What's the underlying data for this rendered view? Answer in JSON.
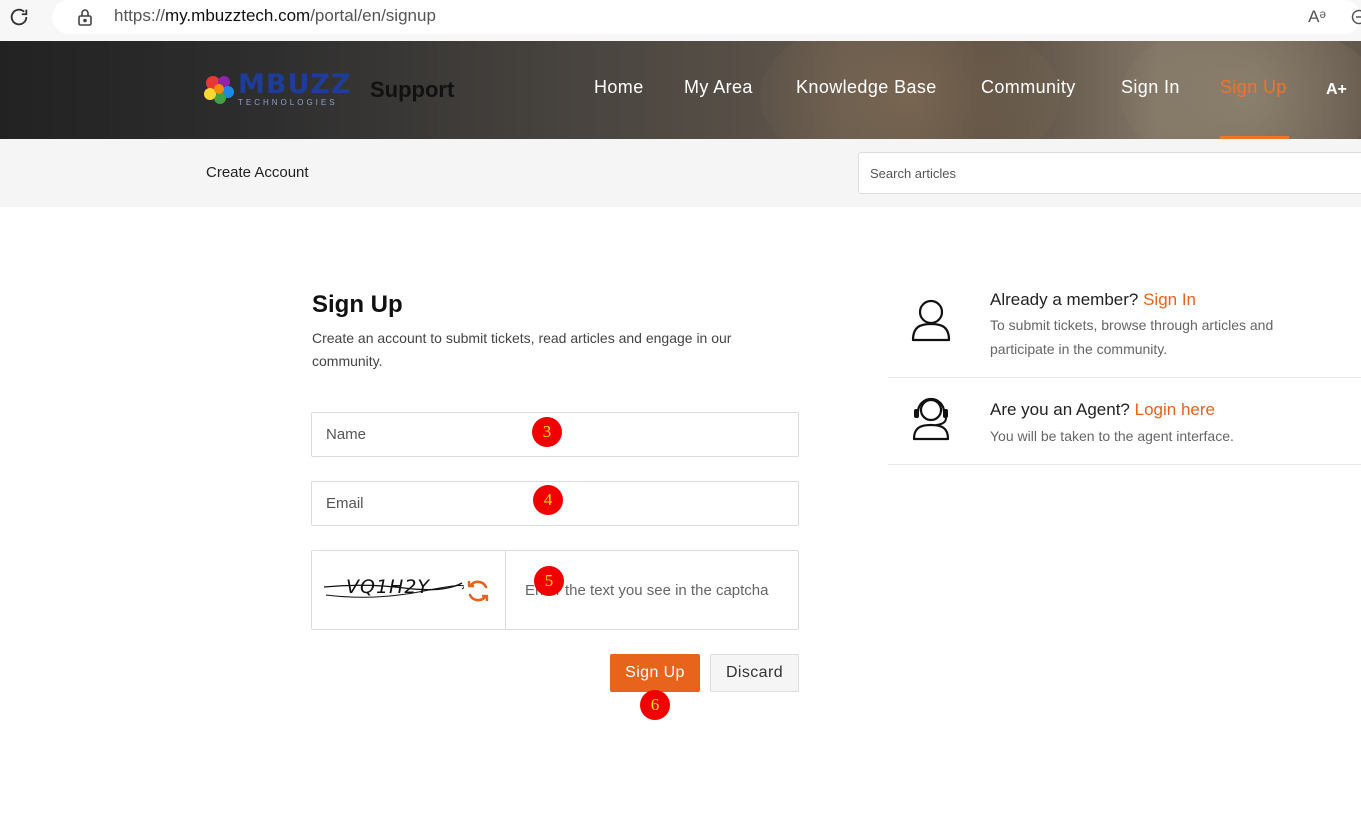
{
  "browser": {
    "url_prefix": "https://",
    "url_host": "my.mbuzztech.com",
    "url_path": "/portal/en/signup",
    "read_aloud_icon": "Aᵊ"
  },
  "header": {
    "logo_main": "MBUZZ",
    "logo_sub": "TECHNOLOGIES",
    "portal_name": "Support",
    "nav": [
      {
        "label": "Home"
      },
      {
        "label": "My Area"
      },
      {
        "label": "Knowledge Base"
      },
      {
        "label": "Community"
      },
      {
        "label": "Sign In"
      },
      {
        "label": "Sign Up"
      }
    ],
    "a11y_label": "A+",
    "accent_color": "#f0742a"
  },
  "subbar": {
    "breadcrumb": "Create Account",
    "search_placeholder": "Search articles"
  },
  "form": {
    "title": "Sign Up",
    "description": "Create an account to submit tickets, read articles and engage in our community.",
    "name_placeholder": "Name",
    "email_placeholder": "Email",
    "captcha_text": "VQ1H2Y",
    "captcha_placeholder": "Enter the text you see in the captcha",
    "submit_label": "Sign Up",
    "discard_label": "Discard"
  },
  "markers": [
    "3",
    "4",
    "5",
    "6"
  ],
  "sidebar": {
    "member": {
      "question": "Already a member?",
      "link": "Sign In",
      "text": "To submit tickets, browse through articles and participate in the community."
    },
    "agent": {
      "question": "Are you an Agent?",
      "link": "Login here",
      "text": "You will be taken to the agent interface."
    }
  },
  "icons": {
    "reload": "reload-icon",
    "lock": "lock-icon",
    "refresh": "refresh-icon",
    "member": "user-icon",
    "agent": "headset-agent-icon"
  }
}
